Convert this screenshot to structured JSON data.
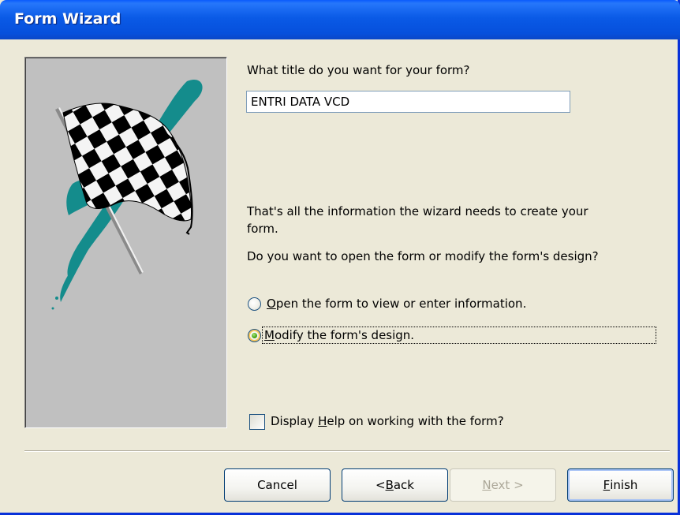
{
  "window": {
    "title": "Form Wizard"
  },
  "colors": {
    "title_bar": "#0a5ae6",
    "dialog_bg": "#ece9d8",
    "picture_bg": "#c0c0c0",
    "flag_teal": "#148c8c"
  },
  "picture": {
    "icon": "checkered-flag-icon"
  },
  "form": {
    "title_prompt": "What title do you want for your form?",
    "title_value": "ENTRI DATA VCD",
    "info_line1": "That's all the information the wizard needs to create your",
    "info_line2": "form.",
    "open_or_modify_prompt": "Do you want to open the form or modify the form's design?",
    "options": [
      {
        "label_key": "O",
        "label_rest": "pen the form to view or enter information.",
        "selected": false
      },
      {
        "label_key": "M",
        "label_rest": "odify the form's design.",
        "selected": true
      }
    ],
    "help_checkbox": {
      "label_pre": "Display ",
      "label_key": "H",
      "label_rest": "elp on working with the form?",
      "checked": false
    }
  },
  "buttons": {
    "cancel": "Cancel",
    "back_pre": "< ",
    "back_key": "B",
    "back_rest": "ack",
    "next_key": "N",
    "next_rest": "ext >",
    "finish_key": "F",
    "finish_rest": "inish"
  }
}
